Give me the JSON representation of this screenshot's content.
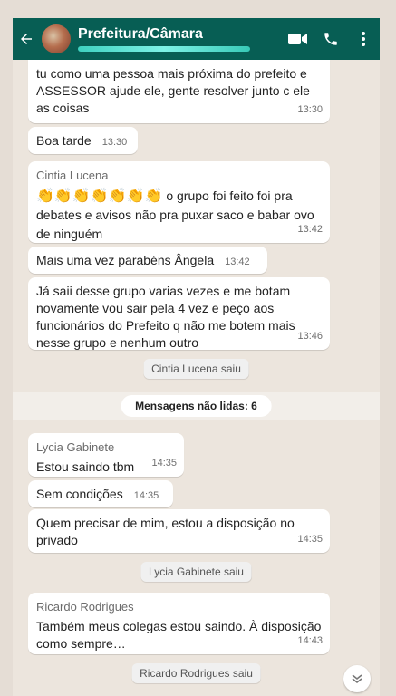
{
  "header": {
    "title": "Prefeitura/Câmara"
  },
  "messages": {
    "m1": {
      "text": "tu como uma pessoa mais próxima do prefeito e ASSESSOR  ajude ele, gente resolver junto c ele as coisas",
      "time": "13:30"
    },
    "m2": {
      "text": "Boa tarde",
      "time": "13:30"
    },
    "m3": {
      "sender": "Cintia Lucena",
      "emoji": "👏👏👏👏👏👏👏",
      "text": " o grupo foi feito foi pra debates e avisos não pra puxar saco e babar ovo de ninguém",
      "time": "13:42"
    },
    "m4": {
      "text": "Mais uma vez parabéns Ângela",
      "time": "13:42"
    },
    "m5": {
      "text": "Já saii desse grupo varias vezes e me botam novamente vou sair pela 4 vez e peço aos funcionários do Prefeito q não me botem mais nesse grupo e nenhum outro",
      "time": "13:46"
    },
    "s1": "Cintia Lucena saiu",
    "unread": "Mensagens não lidas: 6",
    "m6": {
      "sender": "Lycia Gabinete",
      "text": "Estou saindo tbm",
      "time": "14:35"
    },
    "m7": {
      "text": "Sem condições",
      "time": "14:35"
    },
    "m8": {
      "text": "Quem precisar de mim, estou a disposição no privado",
      "time": "14:35"
    },
    "s2": "Lycia Gabinete saiu",
    "m9": {
      "sender": "Ricardo Rodrigues",
      "text": "Também meus colegas estou saindo. À disposição como sempre…",
      "time": "14:43"
    },
    "s3": "Ricardo Rodrigues saiu"
  },
  "colors": {
    "header": "#075e54",
    "chat_bg": "#ece5dd",
    "bubble": "#ffffff"
  },
  "icons": [
    "back-arrow-icon",
    "video-call-icon",
    "voice-call-icon",
    "more-options-icon",
    "scroll-down-icon"
  ]
}
